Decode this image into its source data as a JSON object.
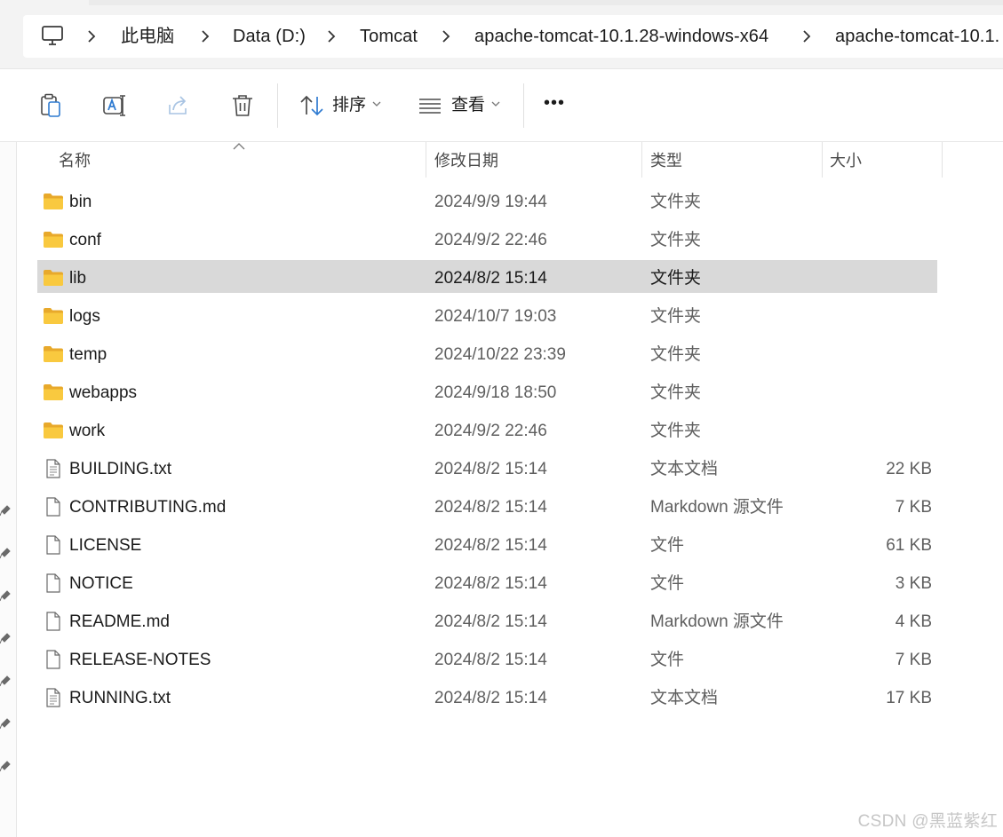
{
  "breadcrumb": {
    "items": [
      "此电脑",
      "Data (D:)",
      "Tomcat",
      "apache-tomcat-10.1.28-windows-x64",
      "apache-tomcat-10.1."
    ]
  },
  "toolbar": {
    "sort_label": "排序",
    "view_label": "查看",
    "more_label": "•••"
  },
  "columns": {
    "name": "名称",
    "date": "修改日期",
    "type": "类型",
    "size": "大小"
  },
  "files": [
    {
      "name": "bin",
      "date": "2024/9/9 19:44",
      "type": "文件夹",
      "size": "",
      "kind": "folder"
    },
    {
      "name": "conf",
      "date": "2024/9/2 22:46",
      "type": "文件夹",
      "size": "",
      "kind": "folder"
    },
    {
      "name": "lib",
      "date": "2024/8/2 15:14",
      "type": "文件夹",
      "size": "",
      "kind": "folder",
      "selected": true
    },
    {
      "name": "logs",
      "date": "2024/10/7 19:03",
      "type": "文件夹",
      "size": "",
      "kind": "folder"
    },
    {
      "name": "temp",
      "date": "2024/10/22 23:39",
      "type": "文件夹",
      "size": "",
      "kind": "folder"
    },
    {
      "name": "webapps",
      "date": "2024/9/18 18:50",
      "type": "文件夹",
      "size": "",
      "kind": "folder"
    },
    {
      "name": "work",
      "date": "2024/9/2 22:46",
      "type": "文件夹",
      "size": "",
      "kind": "folder"
    },
    {
      "name": "BUILDING.txt",
      "date": "2024/8/2 15:14",
      "type": "文本文档",
      "size": "22 KB",
      "kind": "text"
    },
    {
      "name": "CONTRIBUTING.md",
      "date": "2024/8/2 15:14",
      "type": "Markdown 源文件",
      "size": "7 KB",
      "kind": "file"
    },
    {
      "name": "LICENSE",
      "date": "2024/8/2 15:14",
      "type": "文件",
      "size": "61 KB",
      "kind": "file"
    },
    {
      "name": "NOTICE",
      "date": "2024/8/2 15:14",
      "type": "文件",
      "size": "3 KB",
      "kind": "file"
    },
    {
      "name": "README.md",
      "date": "2024/8/2 15:14",
      "type": "Markdown 源文件",
      "size": "4 KB",
      "kind": "file"
    },
    {
      "name": "RELEASE-NOTES",
      "date": "2024/8/2 15:14",
      "type": "文件",
      "size": "7 KB",
      "kind": "file"
    },
    {
      "name": "RUNNING.txt",
      "date": "2024/8/2 15:14",
      "type": "文本文档",
      "size": "17 KB",
      "kind": "text"
    }
  ],
  "watermark": "CSDN @黑蓝紫红",
  "colors": {
    "selection": "#d9d9d9",
    "folder": "#f9c93f",
    "accent": "#0067c0"
  }
}
